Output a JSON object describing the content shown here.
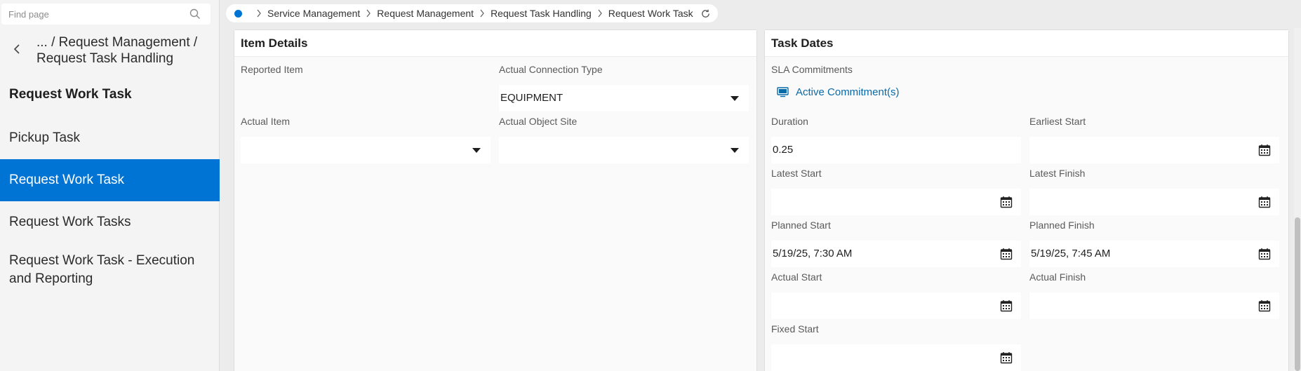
{
  "sidebar": {
    "search_placeholder": "Find page",
    "path": "... / Request Management / Request Task Handling",
    "page_heading": "Request Work Task",
    "items": [
      {
        "label": "Pickup Task"
      },
      {
        "label": "Request Work Task"
      },
      {
        "label": "Request Work Tasks"
      },
      {
        "label": "Request Work Task - Execution and Reporting"
      }
    ]
  },
  "breadcrumb": [
    "Service Management",
    "Request Management",
    "Request Task Handling",
    "Request Work Task"
  ],
  "item_details": {
    "title": "Item Details",
    "reported_item": {
      "label": "Reported Item"
    },
    "actual_connection_type": {
      "label": "Actual Connection Type",
      "value": "EQUIPMENT"
    },
    "actual_item": {
      "label": "Actual Item",
      "value": ""
    },
    "actual_object_site": {
      "label": "Actual Object Site",
      "value": ""
    }
  },
  "task_dates": {
    "title": "Task Dates",
    "sla_label": "SLA Commitments",
    "sla_link": "Active Commitment(s)",
    "duration": {
      "label": "Duration",
      "value": "0.25"
    },
    "earliest_start": {
      "label": "Earliest Start",
      "value": ""
    },
    "latest_start": {
      "label": "Latest Start",
      "value": ""
    },
    "latest_finish": {
      "label": "Latest Finish",
      "value": ""
    },
    "planned_start": {
      "label": "Planned Start",
      "value": "5/19/25, 7:30 AM"
    },
    "planned_finish": {
      "label": "Planned Finish",
      "value": "5/19/25, 7:45 AM"
    },
    "actual_start": {
      "label": "Actual Start",
      "value": ""
    },
    "actual_finish": {
      "label": "Actual Finish",
      "value": ""
    },
    "fixed_start": {
      "label": "Fixed Start",
      "value": ""
    }
  },
  "colors": {
    "accent": "#0074d4",
    "link": "#0a6aa8"
  },
  "icons": [
    "search-icon",
    "back-chevron-icon",
    "chevron-right-icon",
    "refresh-icon",
    "dropdown-caret-icon",
    "calendar-icon",
    "monitor-icon"
  ]
}
